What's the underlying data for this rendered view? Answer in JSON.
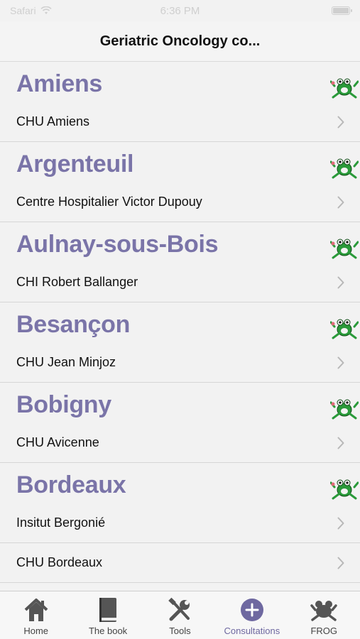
{
  "status": {
    "carrier": "Safari",
    "time": "6:36 PM"
  },
  "nav": {
    "title": "Geriatric Oncology co..."
  },
  "sections": [
    {
      "city": "Amiens",
      "rows": [
        "CHU Amiens"
      ]
    },
    {
      "city": "Argenteuil",
      "rows": [
        "Centre Hospitalier Victor Dupouy"
      ]
    },
    {
      "city": "Aulnay-sous-Bois",
      "rows": [
        "CHI Robert Ballanger"
      ]
    },
    {
      "city": "Besançon",
      "rows": [
        "CHU Jean Minjoz"
      ]
    },
    {
      "city": "Bobigny",
      "rows": [
        "CHU Avicenne"
      ]
    },
    {
      "city": "Bordeaux",
      "rows": [
        "Insitut Bergonié",
        "CHU Bordeaux"
      ]
    }
  ],
  "tabs": [
    {
      "label": "Home",
      "icon": "home-icon"
    },
    {
      "label": "The book",
      "icon": "book-icon"
    },
    {
      "label": "Tools",
      "icon": "tools-icon"
    },
    {
      "label": "Consultations",
      "icon": "plus-circle-icon",
      "active": true
    },
    {
      "label": "FROG",
      "icon": "frog-icon"
    }
  ],
  "colors": {
    "accent": "#7a74a8",
    "tab_active": "#6e68a0",
    "frog_green": "#2a9a3a"
  }
}
